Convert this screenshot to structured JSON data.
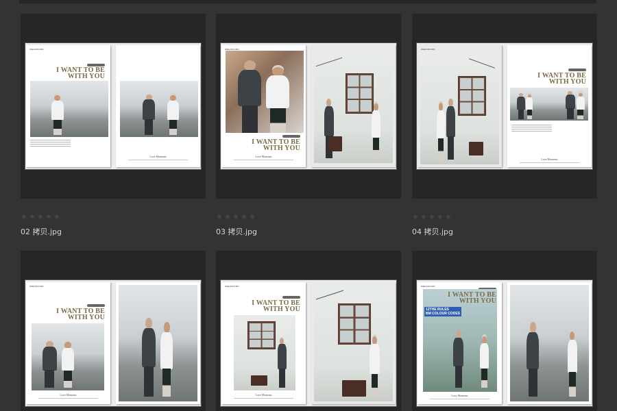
{
  "gallery": {
    "headline_line1": "I WANT TO BE",
    "headline_line2": "WITH YOU",
    "brand": "WEEKWORD",
    "signature": "Love Moments",
    "sign_board_line1": "12THE RULES",
    "sign_board_line2": "BM COLOUR CODES",
    "items": [
      {
        "filename": "02 拷贝.jpg",
        "rating": 0,
        "stars": [
          "★",
          "★",
          "★",
          "★",
          "★"
        ]
      },
      {
        "filename": "03 拷贝.jpg",
        "rating": 0,
        "stars": [
          "★",
          "★",
          "★",
          "★",
          "★"
        ]
      },
      {
        "filename": "04 拷贝.jpg",
        "rating": 0,
        "stars": [
          "★",
          "★",
          "★",
          "★",
          "★"
        ]
      },
      {
        "filename": "",
        "rating": 0,
        "stars": []
      },
      {
        "filename": "",
        "rating": 0,
        "stars": []
      },
      {
        "filename": "",
        "rating": 0,
        "stars": []
      }
    ]
  },
  "colors": {
    "background": "#333333",
    "frame": "#262626",
    "headline": "#7a6a45",
    "star_empty": "#474747",
    "filename_text": "#d6d6d6"
  }
}
